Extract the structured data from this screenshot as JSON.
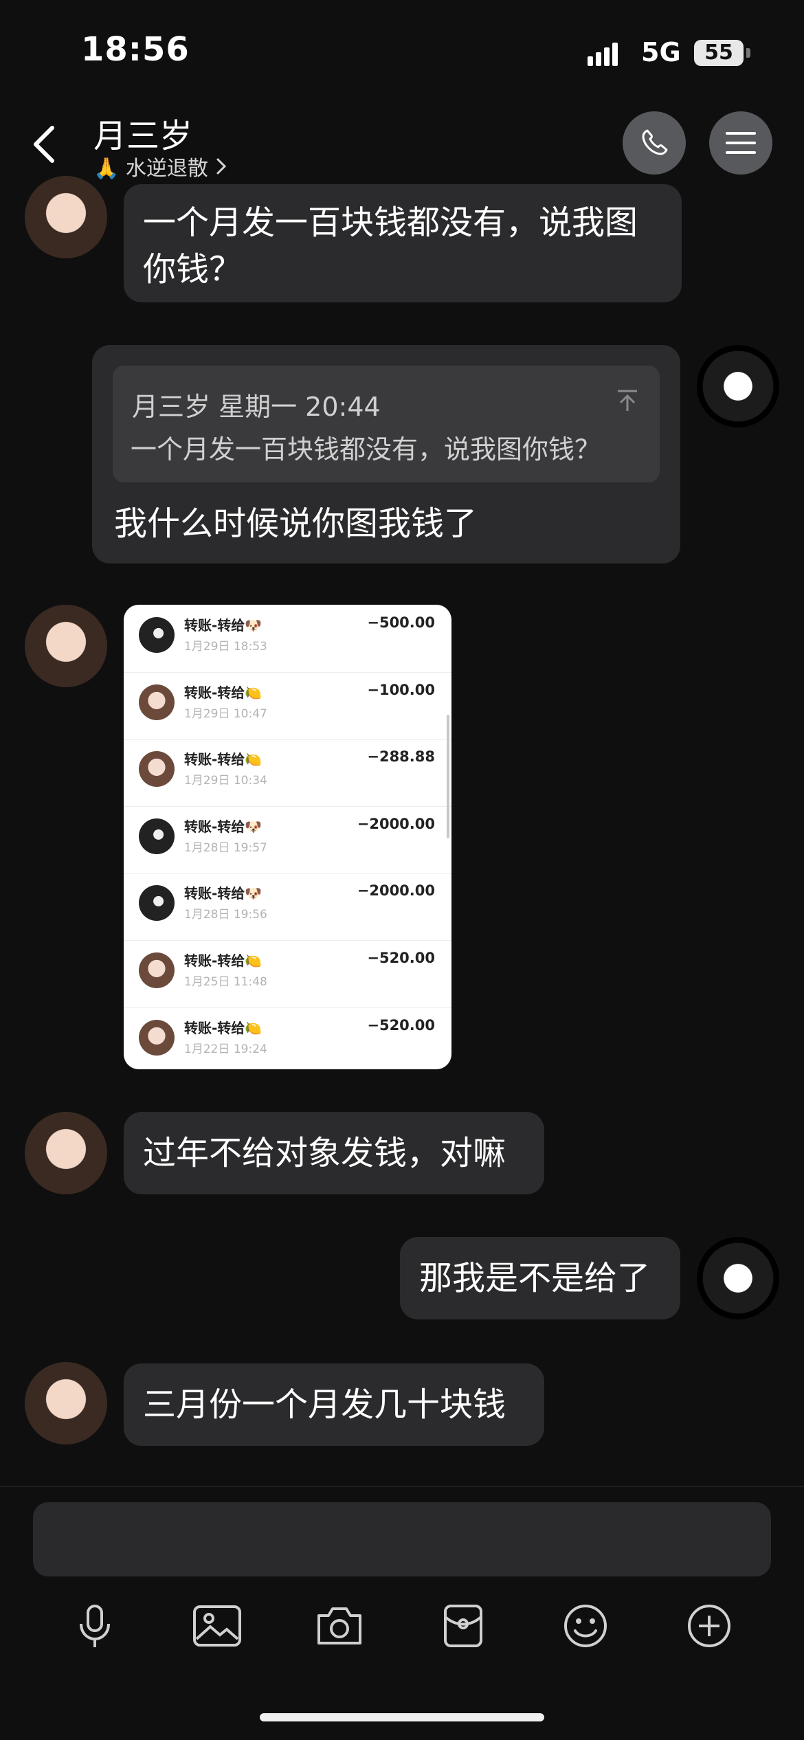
{
  "status": {
    "time": "18:56",
    "network": "5G",
    "battery": "55"
  },
  "header": {
    "title": "月三岁",
    "subtitle": "🙏 水逆退散"
  },
  "messages": {
    "m1": {
      "line1": "一个月发一百块钱都没有，说我图",
      "line2": "你钱？"
    },
    "m2": {
      "quote_header": "月三岁  星期一 20:44",
      "quote_text": "一个月发一百块钱都没有，说我图你钱？",
      "text": "我什么时候说你图我钱了"
    },
    "m4": {
      "text": "过年不给对象发钱，对嘛"
    },
    "m5": {
      "text": "那我是不是给了"
    },
    "m6": {
      "text": "三月份一个月发几十块钱"
    }
  },
  "transfers": [
    {
      "label": "转账-转给🐶",
      "date": "1月29日 18:53",
      "amount": "−500.00",
      "avatar": "dark"
    },
    {
      "label": "转账-转给🍋",
      "date": "1月29日 10:47",
      "amount": "−100.00",
      "avatar": "light"
    },
    {
      "label": "转账-转给🍋",
      "date": "1月29日 10:34",
      "amount": "−288.88",
      "avatar": "light"
    },
    {
      "label": "转账-转给🐶",
      "date": "1月28日 19:57",
      "amount": "−2000.00",
      "avatar": "dark"
    },
    {
      "label": "转账-转给🐶",
      "date": "1月28日 19:56",
      "amount": "−2000.00",
      "avatar": "dark"
    },
    {
      "label": "转账-转给🍋",
      "date": "1月25日 11:48",
      "amount": "−520.00",
      "avatar": "light"
    },
    {
      "label": "转账-转给🍋",
      "date": "1月22日 19:24",
      "amount": "−520.00",
      "avatar": "light"
    }
  ],
  "toolbar": [
    "microphone-icon",
    "image-icon",
    "camera-icon",
    "red-packet-icon",
    "emoji-icon",
    "plus-icon"
  ],
  "colors": {
    "background": "#0f0f10",
    "bubble": "#2b2b2d",
    "quote": "#3a3a3d",
    "header_button": "#58595c"
  }
}
